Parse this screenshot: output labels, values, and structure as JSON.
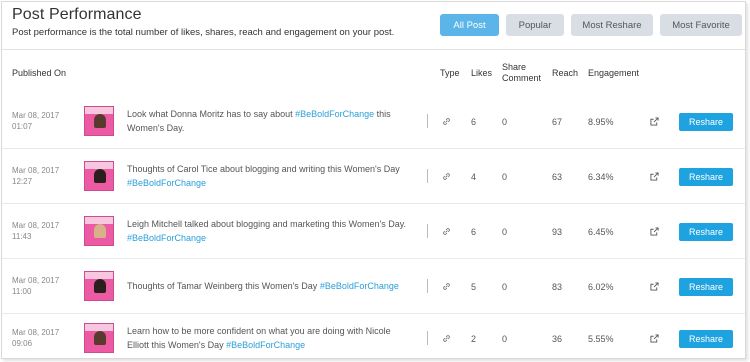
{
  "header": {
    "title": "Post Performance",
    "subtitle": "Post performance is the total number of likes, shares, reach and engagement on your post."
  },
  "filters": [
    {
      "label": "All Post",
      "active": true
    },
    {
      "label": "Popular",
      "active": false
    },
    {
      "label": "Most Reshare",
      "active": false
    },
    {
      "label": "Most Favorite",
      "active": false
    }
  ],
  "columns": {
    "published": "Published On",
    "type": "Type",
    "likes": "Likes",
    "share_comment_1": "Share",
    "share_comment_2": "Comment",
    "reach": "Reach",
    "engagement": "Engagement"
  },
  "rows": [
    {
      "date": "Mar 08, 2017",
      "time": "01:07",
      "text": "Look what Donna Moritz has to say about ",
      "hashtag": "#BeBoldForChange",
      "text_after": " this Women's Day.",
      "likes": "6",
      "share_comment": "0",
      "reach": "67",
      "engagement": "8.95%",
      "action": "Reshare"
    },
    {
      "date": "Mar 08, 2017",
      "time": "12:27",
      "text": "Thoughts of Carol Tice about blogging and writing this Women's Day ",
      "hashtag": "#BeBoldForChange",
      "text_after": "",
      "likes": "4",
      "share_comment": "0",
      "reach": "63",
      "engagement": "6.34%",
      "action": "Reshare"
    },
    {
      "date": "Mar 08, 2017",
      "time": "11:43",
      "text": "Leigh Mitchell talked about blogging and marketing this Women's Day. ",
      "hashtag": "#BeBoldForChange",
      "text_after": "",
      "likes": "6",
      "share_comment": "0",
      "reach": "93",
      "engagement": "6.45%",
      "action": "Reshare"
    },
    {
      "date": "Mar 08, 2017",
      "time": "11:00",
      "text": "Thoughts of Tamar Weinberg this Women's Day ",
      "hashtag": "#BeBoldForChange",
      "text_after": "",
      "likes": "5",
      "share_comment": "0",
      "reach": "83",
      "engagement": "6.02%",
      "action": "Reshare"
    },
    {
      "date": "Mar 08, 2017",
      "time": "09:06",
      "text": "Learn how to be more confident on what you are doing with Nicole Elliott this Women's Day ",
      "hashtag": "#BeBoldForChange",
      "text_after": "",
      "likes": "2",
      "share_comment": "0",
      "reach": "36",
      "engagement": "5.55%",
      "action": "Reshare"
    }
  ],
  "icons": {
    "type": "link-icon",
    "open": "external-link-icon"
  },
  "colors": {
    "accent": "#1fa3e0",
    "active_filter": "#5cb5e8",
    "hashtag": "#2a9fd8",
    "thumbnail": "#ec5aa4"
  }
}
